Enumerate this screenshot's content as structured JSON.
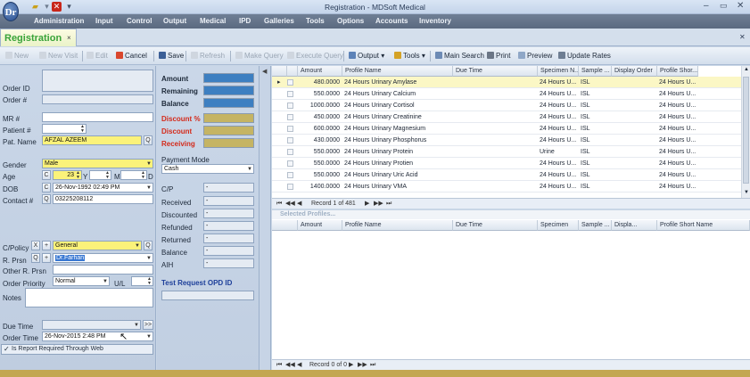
{
  "window": {
    "title": "Registration - MDSoft Medical",
    "logo_text": "Dr"
  },
  "menu": [
    "Administration",
    "Input",
    "Control",
    "Output",
    "Medical",
    "IPD",
    "Galleries",
    "Tools",
    "Options",
    "Accounts",
    "Inventory"
  ],
  "tab": {
    "label": "Registration",
    "close": "×"
  },
  "toolbar": {
    "new": "New",
    "new_visit": "New Visit",
    "edit": "Edit",
    "cancel": "Cancel",
    "save": "Save",
    "refresh": "Refresh",
    "make_query": "Make Query",
    "execute_query": "Execute Query",
    "output": "Output",
    "tools": "Tools",
    "main_search": "Main Search",
    "print": "Print",
    "preview": "Preview",
    "update_rates": "Update Rates"
  },
  "form": {
    "order_id_label": "Order ID",
    "order_no_label": "Order #",
    "mr_label": "MR #",
    "patient_label": "Patient #",
    "pat_name_label": "Pat. Name",
    "pat_name": "AFZAL AZEEM",
    "q": "Q",
    "gender_label": "Gender",
    "gender": "Male",
    "age_label": "Age",
    "age_c": "C",
    "age_years": "23",
    "y": "Y",
    "m": "M",
    "d": "D",
    "dob_label": "DOB",
    "dob": "26-Nov-1992 02:49 PM",
    "contact_label": "Contact #",
    "contact": "03225208112",
    "cpolicy_label": "C/Policy",
    "cpolicy": "General",
    "x": "X",
    "plus": "+",
    "rprsn_label": "R. Prsn",
    "rprsn": "Dr.Farhan",
    "other_rprsn_label": "Other R. Prsn",
    "order_priority_label": "Order Priority",
    "order_priority": "Normal",
    "ul_label": "U/L",
    "notes_label": "Notes",
    "due_time_label": "Due Time",
    "order_time_label": "Order Time",
    "order_time": "26-Nov-2015 2:48 PM",
    "web_report": "Is Report Required Through Web"
  },
  "billing": {
    "amount": "Amount",
    "remaining": "Remaining",
    "balance": "Balance",
    "discount_pct": "Discount %",
    "discount": "Discount",
    "receiving": "Receiving",
    "payment_mode_label": "Payment Mode",
    "payment_mode": "Cash",
    "cp": "C/P",
    "received": "Received",
    "discounted": "Discounted",
    "refunded": "Refunded",
    "returned": "Returned",
    "balance2": "Balance",
    "aih": "AIH",
    "dash": "-",
    "test_request": "Test Request OPD ID",
    "colors": {
      "blue": "#3d7fc1",
      "tan": "#c5b463",
      "red_label": "#d42a1a",
      "blue_label": "#1e3f9a"
    }
  },
  "grid_top": {
    "columns": [
      "Amount",
      "Profile Name",
      "Due Time",
      "Specimen N...",
      "Sample ...",
      "Display Order",
      "Profile Shor..."
    ],
    "rows": [
      {
        "amount": "480.0000",
        "name": "24 Hours Urinary Amylase",
        "specimen": "24 Hours U...",
        "sample": "ISL",
        "short": "24 Hours U..."
      },
      {
        "amount": "550.0000",
        "name": "24 Hours Urinary Calcium",
        "specimen": "24 Hours U...",
        "sample": "ISL",
        "short": "24 Hours U..."
      },
      {
        "amount": "1000.0000",
        "name": "24 Hours Urinary Cortisol",
        "specimen": "24 Hours U...",
        "sample": "ISL",
        "short": "24 Hours U..."
      },
      {
        "amount": "450.0000",
        "name": "24 Hours Urinary Creatinine",
        "specimen": "24 Hours U...",
        "sample": "ISL",
        "short": "24 Hours U..."
      },
      {
        "amount": "600.0000",
        "name": "24 Hours Urinary Magnesium",
        "specimen": "24 Hours U...",
        "sample": "ISL",
        "short": "24 Hours U..."
      },
      {
        "amount": "430.0000",
        "name": "24 Hours Urinary Phosphorus",
        "specimen": "24 Hours U...",
        "sample": "ISL",
        "short": "24 Hours U..."
      },
      {
        "amount": "550.0000",
        "name": "24 Hours Urinary Protein",
        "specimen": "Urine",
        "sample": "ISL",
        "short": "24 Hours U..."
      },
      {
        "amount": "550.0000",
        "name": "24 Hours Urinary Protien",
        "specimen": "24 Hours U...",
        "sample": "ISL",
        "short": "24 Hours U..."
      },
      {
        "amount": "550.0000",
        "name": "24 Hours Urinary Uric Acid",
        "specimen": "24 Hours U...",
        "sample": "ISL",
        "short": "24 Hours U..."
      },
      {
        "amount": "1400.0000",
        "name": "24 Hours Urinary VMA",
        "specimen": "24 Hours U...",
        "sample": "ISL",
        "short": "24 Hours U..."
      }
    ],
    "record_nav": "Record 1 of 481"
  },
  "grid_bottom": {
    "title": "Selected Profiles...",
    "columns": [
      "Amount",
      "Profile Name",
      "Due Time",
      "Specimen",
      "Sample ...",
      "Displa...",
      "Profile Short Name"
    ],
    "record_nav": "Record 0 of 0"
  }
}
